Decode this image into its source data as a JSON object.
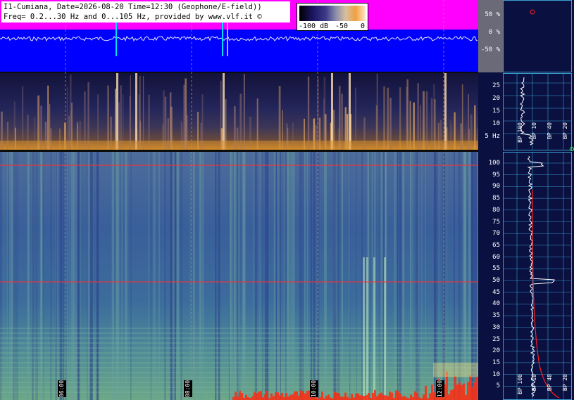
{
  "title": {
    "line1": "I1-Cumiana, Date=2026-08-20 Time=12:30 (Geophone/E-field))",
    "line2": "Freq= 0.2...30 Hz and 0...105 Hz, provided by www.vlf.it ©"
  },
  "colorbar": {
    "min_label": "-100 dB",
    "mid_label": "-50",
    "max_label": "0"
  },
  "waveform_axis": {
    "labels": [
      "50 %",
      "0 %",
      "-50 %"
    ]
  },
  "low_freq_axis": {
    "labels": [
      "25",
      "20",
      "15",
      "10",
      "5 Hz"
    ]
  },
  "high_freq_axis": {
    "labels": [
      "100",
      "95",
      "90",
      "85",
      "80",
      "75",
      "70",
      "65",
      "60",
      "55",
      "50",
      "45",
      "40",
      "35",
      "30",
      "25",
      "20",
      "15",
      "10",
      "5"
    ]
  },
  "time_labels": [
    "06:00",
    "08:00",
    "10:00",
    "12:00"
  ],
  "side_panel": {
    "bp_labels_top": [
      "BP 100",
      "BP 10",
      "BP 40",
      "BP 20"
    ],
    "bp_labels_bottom": [
      "BP 100",
      "BP 10",
      "BP 40",
      "BP 20"
    ]
  },
  "colors": {
    "waveform_bg": "#ff00ff",
    "waveform_fill": "#0000ff",
    "accent_red": "#ff3030",
    "grid_blue": "#3aa0d0"
  }
}
